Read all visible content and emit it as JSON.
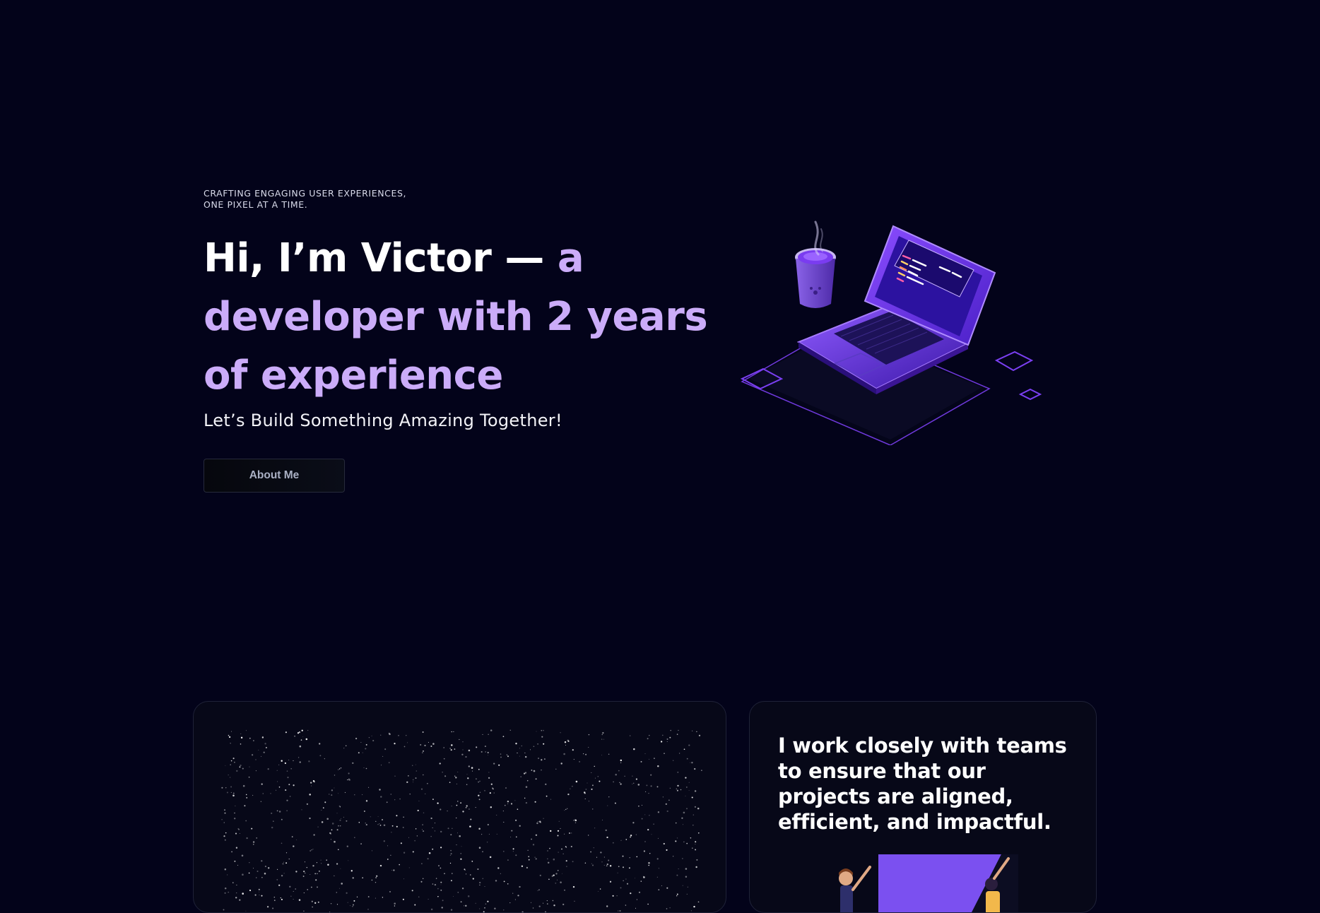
{
  "hero": {
    "tagline": "CRAFTING ENGAGING USER EXPERIENCES, ONE PIXEL AT A TIME.",
    "headline_plain": "Hi, I’m Victor —",
    "headline_accent": " a developer with 2 years of experience",
    "subtitle": "Let’s Build Something Amazing Together!",
    "about_button": "About Me",
    "illustration_icon": "laptop-coffee-isometric-illustration"
  },
  "cards": {
    "stars_card_icon": "starfield-illustration",
    "teams_heading": "I work closely with teams to ensure that our projects are aligned, efficient, and impactful.",
    "teams_illustration_icon": "team-collaboration-illustration"
  },
  "colors": {
    "background": "#03031a",
    "accent": "#cbacf9",
    "purple": "#7b3ff2"
  }
}
